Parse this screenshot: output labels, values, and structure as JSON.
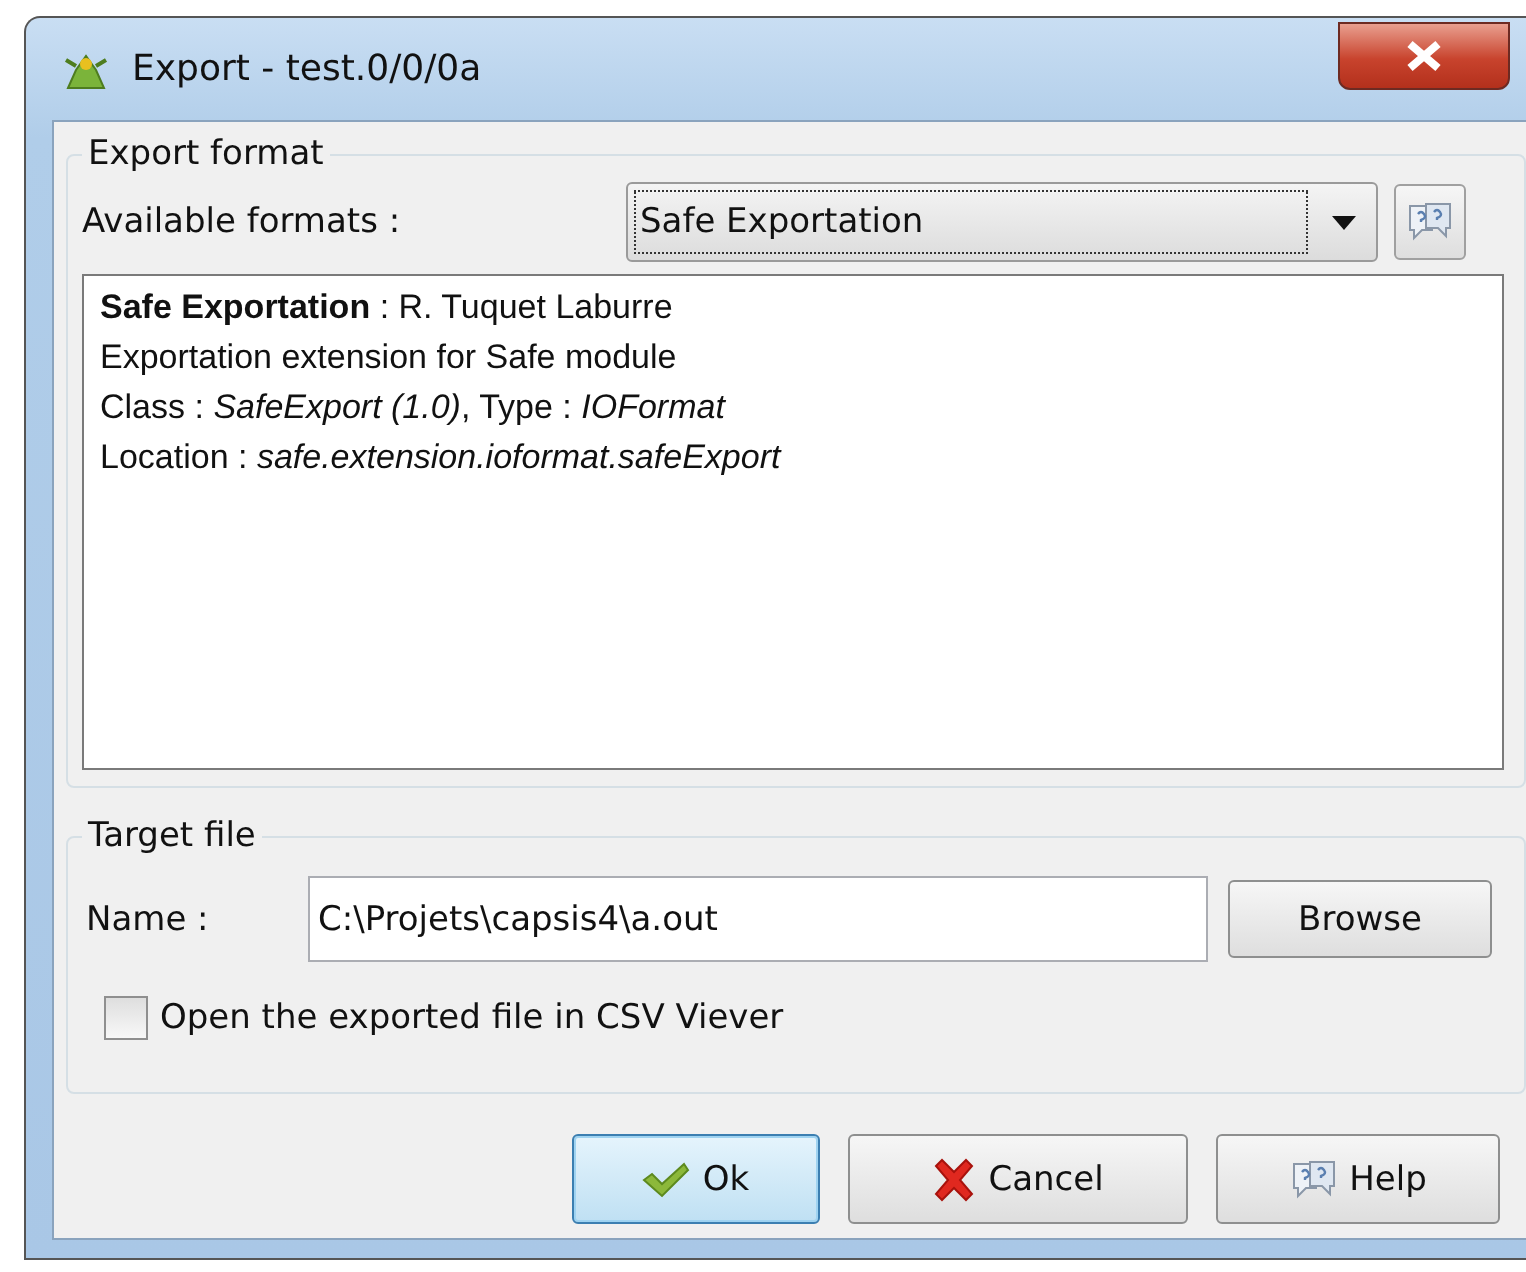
{
  "window": {
    "title": "Export - test.0/0/0a"
  },
  "export_format": {
    "legend": "Export format",
    "formats_label": "Available formats :",
    "selected_format": "Safe Exportation",
    "description": [
      "**Safe Exportation** : R. Tuquet Laburre",
      "Exportation extension for Safe module",
      "Class : *SafeExport (1.0)*, Type : *IOFormat*",
      "Location : *safe.extension.ioformat.safeExport*"
    ]
  },
  "target_file": {
    "legend": "Target file",
    "name_label": "Name :",
    "name_value": "C:\\Projets\\capsis4\\a.out",
    "browse_button": "Browse",
    "open_in_viewer": {
      "label": "Open the exported file in CSV Viever",
      "checked": false
    }
  },
  "buttons": [
    {
      "kind": "ok",
      "label": "Ok",
      "default": true
    },
    {
      "kind": "cancel",
      "label": "Cancel",
      "default": false
    },
    {
      "kind": "help",
      "label": "Help",
      "default": false
    }
  ]
}
